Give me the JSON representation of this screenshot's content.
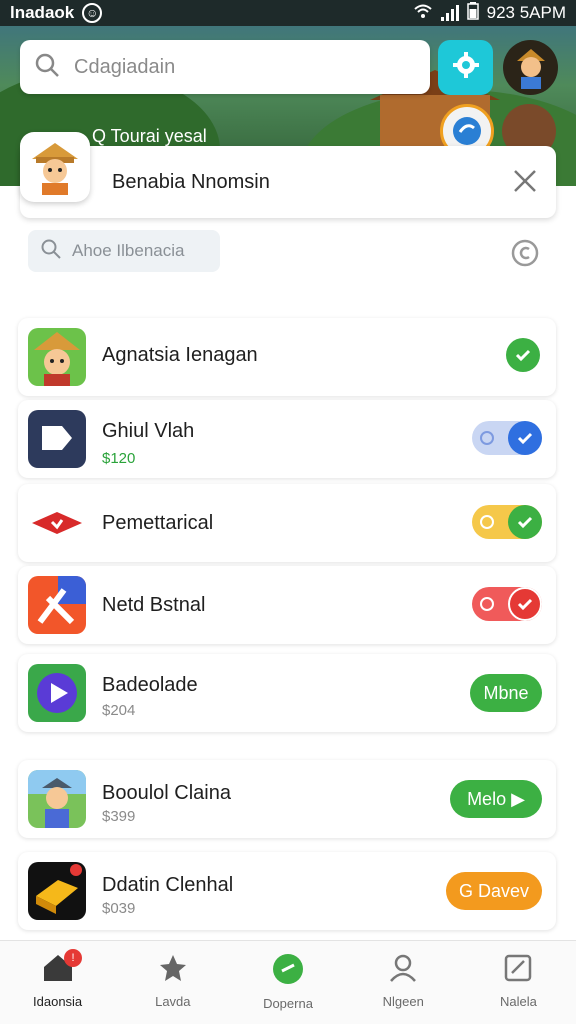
{
  "status_bar": {
    "carrier": "lnadaok",
    "time": "923 5APM"
  },
  "header": {
    "search_placeholder": "Cdagiadain",
    "tour_label": "Q Tourai yesal"
  },
  "banner": {
    "name": "Benabia Nnomsin"
  },
  "filter": {
    "placeholder": "Ahoe Ilbenacia"
  },
  "apps": [
    {
      "title": "Agnatsia Ienagan",
      "price": "",
      "action": "check",
      "icon": "cowboy-avatar-icon"
    },
    {
      "title": "Ghiul Vlah",
      "price": "$120",
      "action": "toggle-blue",
      "icon": "video-app-icon"
    },
    {
      "title": "Pemettarical",
      "price": "",
      "action": "toggle-green",
      "icon": "red-diamond-icon"
    },
    {
      "title": "Netd Bstnal",
      "price": "",
      "action": "toggle-red",
      "icon": "orange-x-app-icon"
    },
    {
      "title": "Badeolade",
      "price": "$204",
      "action": "Mbne",
      "icon": "play-circle-icon"
    },
    {
      "title": "Booulol Claina",
      "price": "$399",
      "action": "Melo ▶",
      "icon": "miner-avatar-icon"
    },
    {
      "title": "Ddatin Clenhal",
      "price": "$039",
      "action": "G Davev",
      "icon": "gold-block-icon"
    }
  ],
  "colors": {
    "accent_green": "#3cb043",
    "accent_cyan": "#1ec8d8",
    "accent_orange": "#f39a1e",
    "toggle_blue": "#2f6fe0",
    "toggle_red": "#e53935"
  },
  "bottom_nav": [
    {
      "label": "Idaonsia",
      "icon": "home-icon",
      "badge": "!"
    },
    {
      "label": "Lavda",
      "icon": "star-house-icon"
    },
    {
      "label": "Doperna",
      "icon": "green-circle-icon"
    },
    {
      "label": "Nlgeen",
      "icon": "user-bell-icon"
    },
    {
      "label": "Nalela",
      "icon": "edit-box-icon"
    }
  ]
}
